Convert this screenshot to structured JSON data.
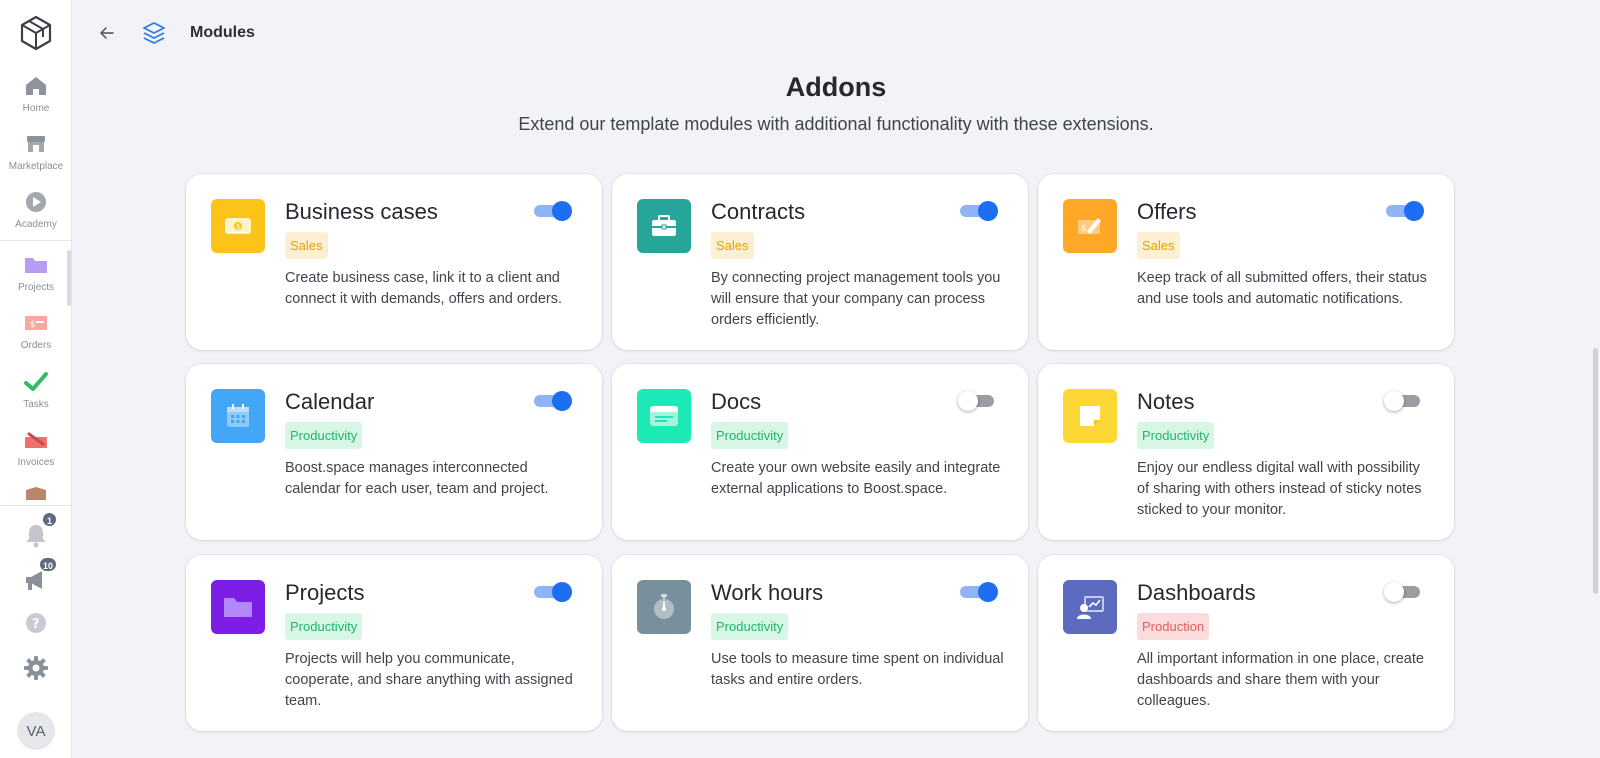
{
  "sidebar": {
    "items": [
      {
        "label": "Home",
        "icon": "home-icon"
      },
      {
        "label": "Marketplace",
        "icon": "store-icon"
      },
      {
        "label": "Academy",
        "icon": "play-icon"
      },
      {
        "label": "Projects",
        "icon": "folder-icon"
      },
      {
        "label": "Orders",
        "icon": "orders-icon"
      },
      {
        "label": "Tasks",
        "icon": "check-icon"
      },
      {
        "label": "Invoices",
        "icon": "invoices-icon"
      }
    ],
    "notifications_count": "1",
    "announcements_count": "10",
    "avatar_initials": "VA"
  },
  "header": {
    "breadcrumb_title": "Modules"
  },
  "page": {
    "title": "Addons",
    "subtitle": "Extend our template modules with additional functionality with these extensions."
  },
  "cards": [
    {
      "title": "Business cases",
      "tag": "Sales",
      "tag_type": "sales",
      "enabled": true,
      "icon": "money-icon",
      "icon_color": "#fcc419",
      "description": "Create business case, link it to a client and connect it with demands, offers and orders."
    },
    {
      "title": "Contracts",
      "tag": "Sales",
      "tag_type": "sales",
      "enabled": true,
      "icon": "briefcase-icon",
      "icon_color": "#26a69a",
      "description": "By connecting project management tools you will ensure that your company can process orders efficiently."
    },
    {
      "title": "Offers",
      "tag": "Sales",
      "tag_type": "sales",
      "enabled": true,
      "icon": "offer-icon",
      "icon_color": "#ffa726",
      "description": "Keep track of all submitted offers, their status and use tools and automatic notifications."
    },
    {
      "title": "Calendar",
      "tag": "Productivity",
      "tag_type": "productivity",
      "enabled": true,
      "icon": "calendar-icon",
      "icon_color": "#42a5f5",
      "description": "Boost.space manages interconnected calendar for each user, team and project."
    },
    {
      "title": "Docs",
      "tag": "Productivity",
      "tag_type": "productivity",
      "enabled": false,
      "icon": "docs-icon",
      "icon_color": "#1de9b6",
      "description": "Create your own website easily and integrate external applications to Boost.space."
    },
    {
      "title": "Notes",
      "tag": "Productivity",
      "tag_type": "productivity",
      "enabled": false,
      "icon": "notes-icon",
      "icon_color": "#fdd835",
      "description": "Enjoy our endless digital wall with possibility of sharing with others instead of sticky notes sticked to your monitor."
    },
    {
      "title": "Projects",
      "tag": "Productivity",
      "tag_type": "productivity",
      "enabled": true,
      "icon": "folder-icon",
      "icon_color": "#7c1ee6",
      "description": "Projects will help you communicate, cooperate, and share anything with assigned team."
    },
    {
      "title": "Work hours",
      "tag": "Productivity",
      "tag_type": "productivity",
      "enabled": true,
      "icon": "stopwatch-icon",
      "icon_color": "#78909c",
      "description": "Use tools to measure time spent on individual tasks and entire orders."
    },
    {
      "title": "Dashboards",
      "tag": "Production",
      "tag_type": "production",
      "enabled": false,
      "icon": "dashboard-icon",
      "icon_color": "#5c6bc0",
      "description": "All important information in one place, create dashboards and share them with your colleagues."
    }
  ]
}
